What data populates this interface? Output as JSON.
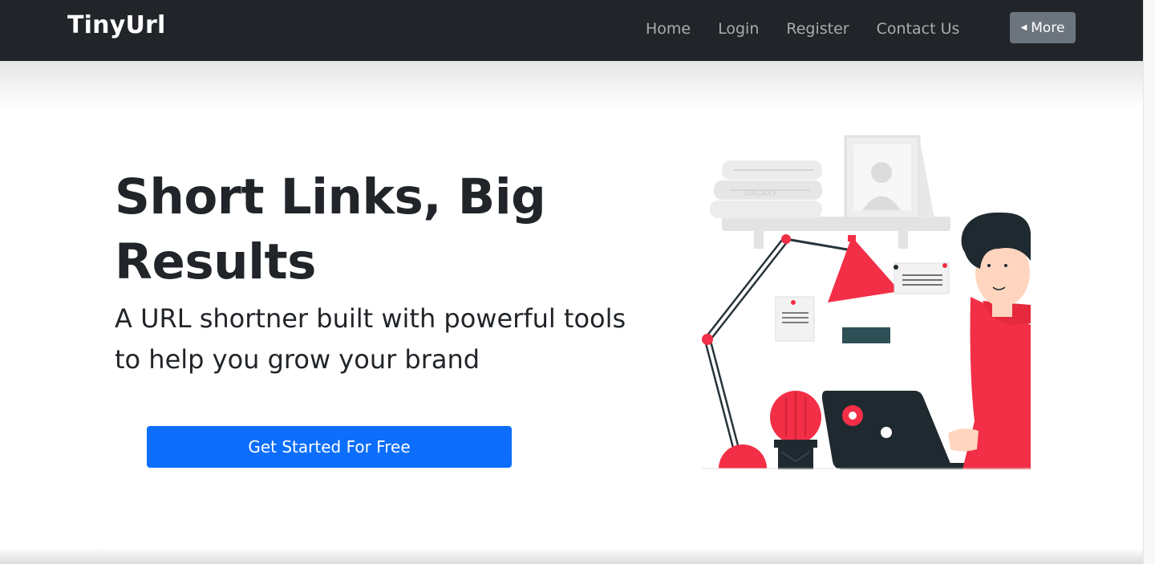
{
  "navbar": {
    "brand": "TinyUrl",
    "links": [
      "Home",
      "Login",
      "Register",
      "Contact Us"
    ],
    "more_label": "More"
  },
  "hero": {
    "title": "Short Links, Big Results",
    "subtitle": "A URL shortner built with powerful tools to help you grow your brand",
    "cta_label": "Get Started For Free"
  },
  "illustration": {
    "book_spine_text": "GALAXY"
  },
  "colors": {
    "navbar_bg": "#212529",
    "nav_link": "#a9abae",
    "more_button": "#6c757d",
    "primary": "#0d6efd",
    "accent_red": "#f22f46",
    "laptop": "#1f2a30"
  }
}
